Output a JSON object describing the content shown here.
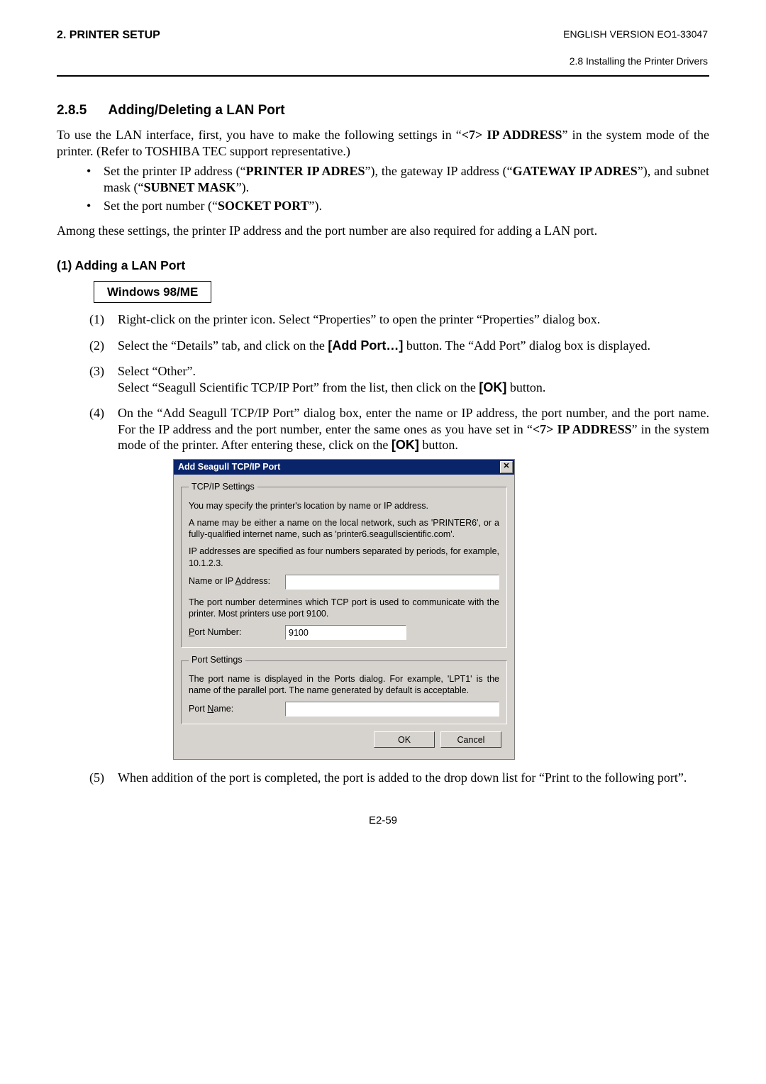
{
  "header": {
    "chapter": "2. PRINTER SETUP",
    "version": "ENGLISH VERSION EO1-33047",
    "sub": "2.8 Installing the Printer Drivers"
  },
  "section": {
    "num": "2.8.5",
    "title": "Adding/Deleting a LAN Port"
  },
  "intro": {
    "t1a": "To use the LAN interface, first, you have to make the following settings in “",
    "t1b": "<7> IP ADDRESS",
    "t1c": "” in the system mode of the printer. (Refer to TOSHIBA TEC support representative.)",
    "b1a": "Set the printer IP address (“",
    "b1b": "PRINTER IP ADRES",
    "b1c": "”), the gateway IP address (“",
    "b1d": "GATEWAY IP ADRES",
    "b1e": "”), and subnet mask (“",
    "b1f": "SUBNET MASK",
    "b1g": "”).",
    "b2a": "Set the port number (“",
    "b2b": "SOCKET PORT",
    "b2c": "”).",
    "t2": "Among these settings, the printer IP address and the port number are also required for adding a LAN port."
  },
  "adding": {
    "title": "(1)  Adding a LAN Port",
    "os": "Windows 98/ME",
    "s1": "Right-click on the printer icon.  Select “Properties” to open the printer “Properties” dialog box.",
    "s2a": "Select the “Details” tab, and click on the ",
    "s2b": "[Add Port…]",
    "s2c": " button.  The “Add Port” dialog box is displayed.",
    "s3a": "Select “Other”.",
    "s3b": "Select “Seagull Scientific TCP/IP Port” from the list, then click on the ",
    "s3c": "[OK]",
    "s3d": " button.",
    "s4a": "On the “Add Seagull TCP/IP Port” dialog box, enter the name or IP address, the port number, and the port name.  For the IP address and the port number, enter the same ones as you have set in “",
    "s4b": "<7> IP ADDRESS",
    "s4c": "” in the system mode of the printer.  After entering these, click on the ",
    "s4d": "[OK]",
    "s4e": " button.",
    "s5": "When addition of the port is completed, the port is added to the drop down list for “Print to the following port”."
  },
  "dialog": {
    "title": "Add Seagull TCP/IP Port",
    "grp1_legend": "TCP/IP Settings",
    "g1_t1": "You may specify the printer's location by name or IP address.",
    "g1_t2": "A name may be either a name on the local network, such as 'PRINTER6', or a fully-qualified internet name, such as 'printer6.seagullscientific.com'.",
    "g1_t3": "IP addresses are specified as four numbers separated by periods, for example, 10.1.2.3.",
    "name_label_pre": "Name or IP ",
    "name_label_u": "A",
    "name_label_post": "ddress:",
    "name_value": "",
    "g1_t4": "The port number determines which TCP port is used to communicate with the printer.  Most printers use port 9100.",
    "port_label_u": "P",
    "port_label_post": "ort Number:",
    "port_value": "9100",
    "grp2_legend": "Port Settings",
    "g2_t1": "The port name is displayed in the Ports dialog.  For example, 'LPT1' is the name of the parallel port.  The name generated by default is acceptable.",
    "pname_label_pre": "Port ",
    "pname_label_u": "N",
    "pname_label_post": "ame:",
    "pname_value": "",
    "ok": "OK",
    "cancel": "Cancel"
  },
  "pageNumber": "E2-59"
}
